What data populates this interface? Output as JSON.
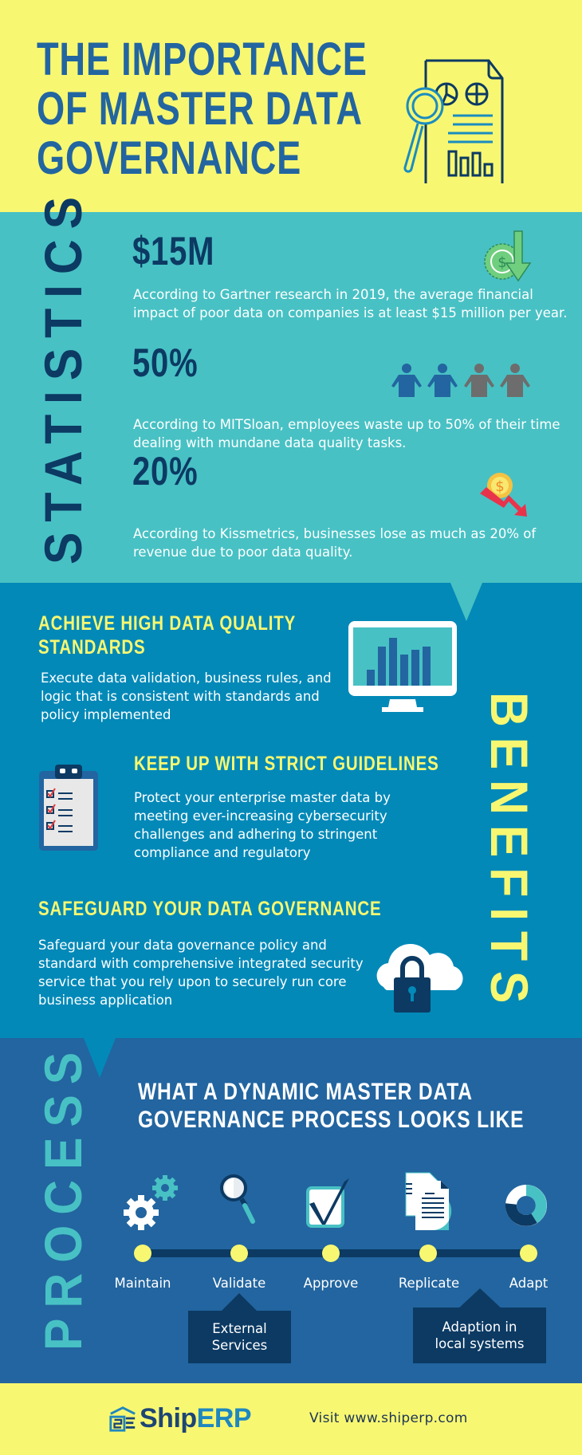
{
  "header": {
    "title_lines": [
      "THE IMPORTANCE",
      "OF MASTER DATA",
      "GOVERNANCE"
    ],
    "icon": "document-analytics-magnifier-icon"
  },
  "statistics": {
    "section_label": "STATISTICS",
    "items": [
      {
        "value": "$15M",
        "description": "According to Gartner research in 2019, the average financial impact of poor data on companies is at least $15 million per year.",
        "icon": "money-coin-down-arrow-icon"
      },
      {
        "value": "50%",
        "description": "According to MITSloan, employees waste up to 50% of their time dealing with mundane data quality tasks.",
        "icon": "people-half-icon",
        "people_highlighted": 2,
        "people_total": 4
      },
      {
        "value": "20%",
        "description": "According to Kissmetrics, businesses lose as much as 20% of revenue due to poor data quality.",
        "icon": "revenue-loss-arrow-icon"
      }
    ]
  },
  "benefits": {
    "section_label": "BENEFITS",
    "items": [
      {
        "title_lines": [
          "ACHIEVE HIGH DATA QUALITY",
          "STANDARDS"
        ],
        "description": "Execute data validation, business rules, and logic that is consistent with standards and policy implemented",
        "icon": "monitor-bar-chart-icon"
      },
      {
        "title_lines": [
          "KEEP UP WITH STRICT GUIDELINES"
        ],
        "description": "Protect your enterprise master data by meeting ever-increasing cybersecurity challenges and adhering to stringent compliance and regulatory",
        "icon": "clipboard-checklist-icon"
      },
      {
        "title_lines": [
          "SAFEGUARD YOUR DATA GOVERNANCE"
        ],
        "description": "Safeguard your data governance policy and standard with comprehensive integrated security service that you rely upon to securely run core business application",
        "icon": "cloud-lock-icon"
      }
    ]
  },
  "process": {
    "section_label": "PROCESS",
    "title_lines": [
      "WHAT A DYNAMIC MASTER DATA",
      "GOVERNANCE PROCESS LOOKS LIKE"
    ],
    "steps": [
      {
        "label": "Maintain",
        "icon": "gears-icon"
      },
      {
        "label": "Validate",
        "icon": "magnifier-icon"
      },
      {
        "label": "Approve",
        "icon": "checkbox-checked-icon"
      },
      {
        "label": "Replicate",
        "icon": "documents-copy-icon"
      },
      {
        "label": "Adapt",
        "icon": "donut-cycle-icon"
      }
    ],
    "callouts": [
      {
        "step": "Validate",
        "lines": [
          "External",
          "Services"
        ]
      },
      {
        "step": "Replicate",
        "lines": [
          "Adaption in",
          "local systems"
        ]
      }
    ]
  },
  "footer": {
    "logo_part1": "Ship",
    "logo_part2": "ERP",
    "visit_text": "Visit www.shiperp.com"
  },
  "colors": {
    "yellow": "#f8f771",
    "teal": "#48c1c4",
    "ocean_blue": "#0289b8",
    "steel_blue": "#2265a0",
    "navy": "#0c3a63"
  }
}
